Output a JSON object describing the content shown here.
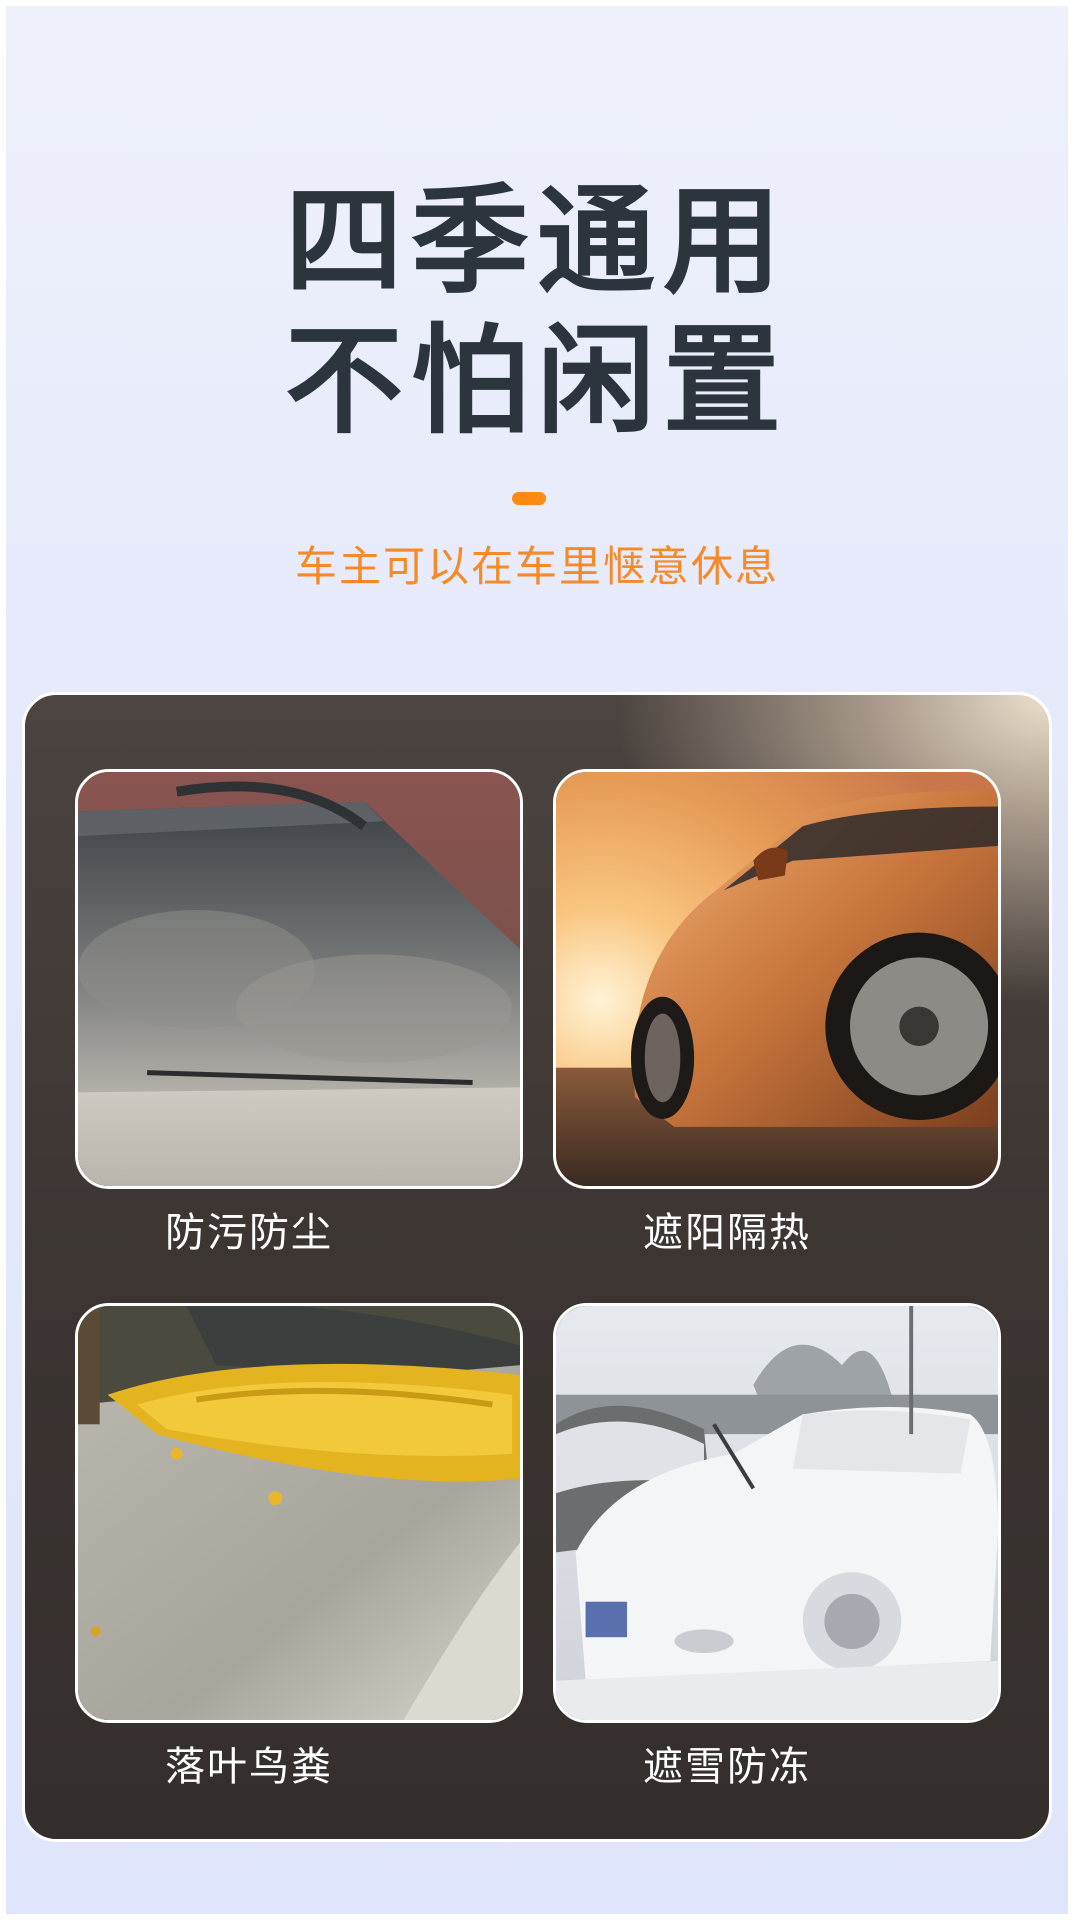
{
  "header": {
    "line1": "四季通用",
    "line2": "不怕闲置",
    "subtitle": "车主可以在车里惬意休息"
  },
  "features": [
    {
      "label": "防污防尘",
      "icon": "dusty-windshield-photo"
    },
    {
      "label": "遮阳隔热",
      "icon": "sunset-car-photo"
    },
    {
      "label": "落叶鸟粪",
      "icon": "fallen-leaves-hood-photo"
    },
    {
      "label": "遮雪防冻",
      "icon": "snow-covered-car-photo"
    }
  ],
  "colors": {
    "headline": "#2c343d",
    "accent": "#ff8a12",
    "subtitle": "#f68a28",
    "panel": "#3d3633"
  }
}
